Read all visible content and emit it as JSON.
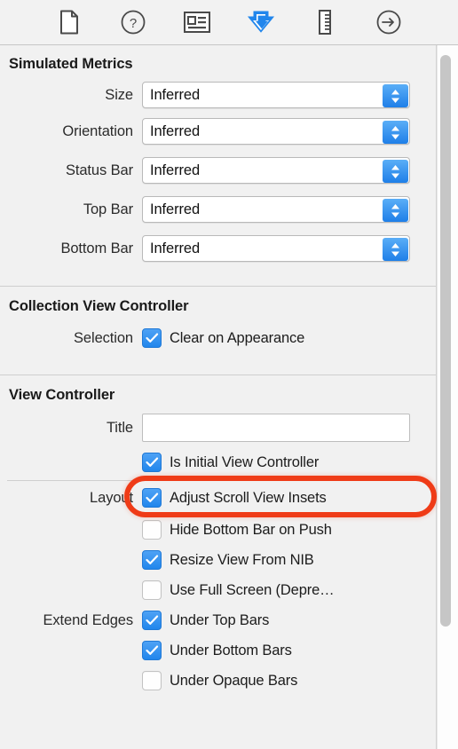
{
  "toolbar": {
    "items": [
      {
        "name": "file-inspector-icon",
        "label": "File Inspector",
        "selected": false
      },
      {
        "name": "quick-help-inspector-icon",
        "label": "Quick Help Inspector",
        "selected": false
      },
      {
        "name": "identity-inspector-icon",
        "label": "Identity Inspector",
        "selected": false
      },
      {
        "name": "attributes-inspector-icon",
        "label": "Attributes Inspector",
        "selected": true
      },
      {
        "name": "size-inspector-icon",
        "label": "Size Inspector",
        "selected": false
      },
      {
        "name": "connections-inspector-icon",
        "label": "Connections Inspector",
        "selected": false
      }
    ],
    "accent_color": "#2186ec"
  },
  "sections": {
    "simulated_metrics": {
      "title": "Simulated Metrics",
      "rows": [
        {
          "label": "Size",
          "value": "Inferred"
        },
        {
          "label": "Orientation",
          "value": "Inferred"
        },
        {
          "label": "Status Bar",
          "value": "Inferred"
        },
        {
          "label": "Top Bar",
          "value": "Inferred"
        },
        {
          "label": "Bottom Bar",
          "value": "Inferred"
        }
      ]
    },
    "collection_view_controller": {
      "title": "Collection View Controller",
      "selection_label": "Selection",
      "selection_option": {
        "label": "Clear on Appearance",
        "checked": true
      }
    },
    "view_controller": {
      "title": "View Controller",
      "title_field": {
        "label": "Title",
        "value": "",
        "placeholder": ""
      },
      "is_initial": {
        "label": "Is Initial View Controller",
        "checked": true
      },
      "layout_label": "Layout",
      "layout_options": [
        {
          "label": "Adjust Scroll View Insets",
          "checked": true
        },
        {
          "label": "Hide Bottom Bar on Push",
          "checked": false
        },
        {
          "label": "Resize View From NIB",
          "checked": true
        },
        {
          "label": "Use Full Screen (Depre…",
          "checked": false
        }
      ],
      "extend_edges_label": "Extend Edges",
      "extend_edges_options": [
        {
          "label": "Under Top Bars",
          "checked": true
        },
        {
          "label": "Under Bottom Bars",
          "checked": true
        },
        {
          "label": "Under Opaque Bars",
          "checked": false
        }
      ]
    }
  },
  "annotation": {
    "target": "Is Initial View Controller",
    "color": "#ef3b17"
  }
}
